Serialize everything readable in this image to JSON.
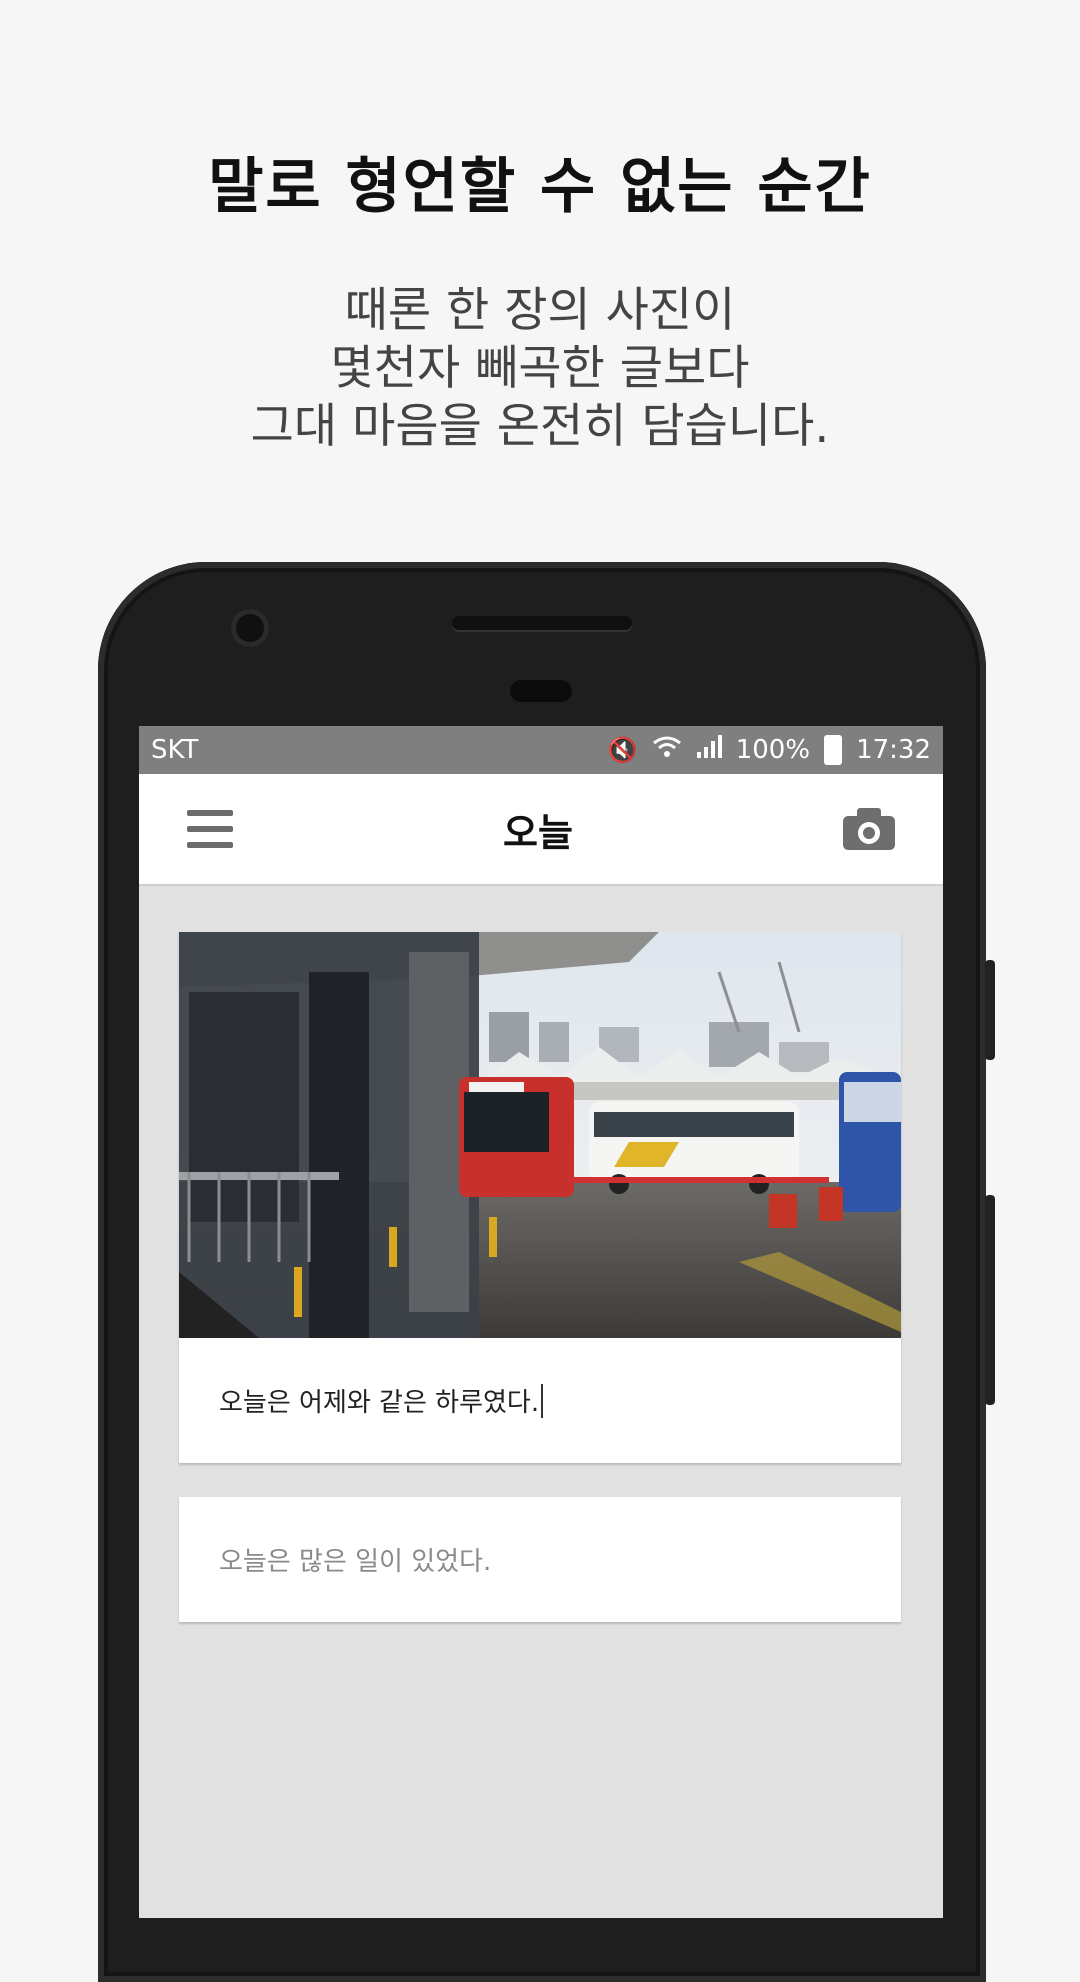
{
  "promo": {
    "headline": "말로 형언할 수 없는 순간",
    "lines": [
      "때론 한 장의 사진이",
      "몇천자 빼곡한 글보다",
      "그대 마음을 온전히 담습니다."
    ]
  },
  "status_bar": {
    "carrier": "SKT",
    "battery": "100%",
    "time": "17:32"
  },
  "app_bar": {
    "title": "오늘"
  },
  "entries": [
    {
      "text": "오늘은 어제와 같은 하루였다."
    },
    {
      "text": "오늘은 많은 일이 있었다."
    }
  ],
  "icons": [
    "menu-icon",
    "camera-icon",
    "mute-icon",
    "wifi-icon",
    "signal-icon",
    "battery-icon"
  ]
}
